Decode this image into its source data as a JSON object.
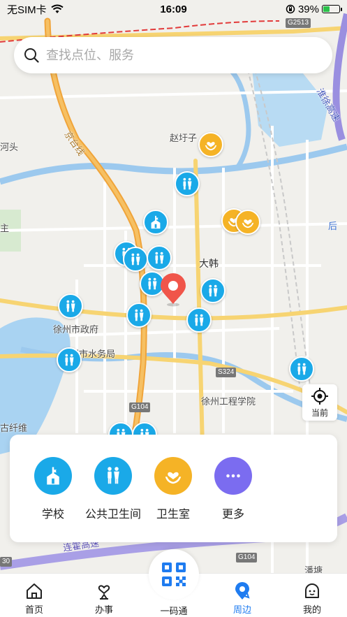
{
  "status_bar": {
    "carrier": "无SIM卡",
    "time": "16:09",
    "battery_pct": "39%",
    "battery_level": 0.39
  },
  "search": {
    "placeholder": "查找点位、服务"
  },
  "map": {
    "labels": {
      "zhao_yuzi": "赵圩子",
      "dahan": "大韩",
      "city_gov": "徐州市政府",
      "water_bureau": "州市水务局",
      "engineering_college": "徐州工程学院",
      "he_tou": "河头",
      "zhu": "主",
      "jing_tai_line": "京台线",
      "xu_highway": "淮徐高速",
      "hou": "后",
      "xian_wei": "古纤维",
      "lian_huo": "连霍高速",
      "pan_tang": "潘塘"
    },
    "road_badges": {
      "g2513": "G2513",
      "s324": "S324",
      "g104_a": "G104",
      "g104_b": "G104",
      "g30": "30"
    }
  },
  "locate_button": {
    "label": "当前"
  },
  "categories": [
    {
      "label": "学校",
      "icon": "school-icon",
      "color": "#1aa9e8"
    },
    {
      "label": "公共卫生间",
      "icon": "restroom-icon",
      "color": "#1aa9e8"
    },
    {
      "label": "卫生室",
      "icon": "clinic-icon",
      "color": "#f5b326"
    },
    {
      "label": "更多",
      "icon": "more-icon",
      "color": "#7b6cf0"
    }
  ],
  "tabs": {
    "home": "首页",
    "affairs": "办事",
    "code": "一码通",
    "nearby": "周边",
    "mine": "我的"
  },
  "colors": {
    "accent": "#1f7cf0",
    "restroom": "#1aa9e8",
    "clinic": "#f5b326",
    "more": "#7b6cf0",
    "marker": "#f0554a"
  }
}
